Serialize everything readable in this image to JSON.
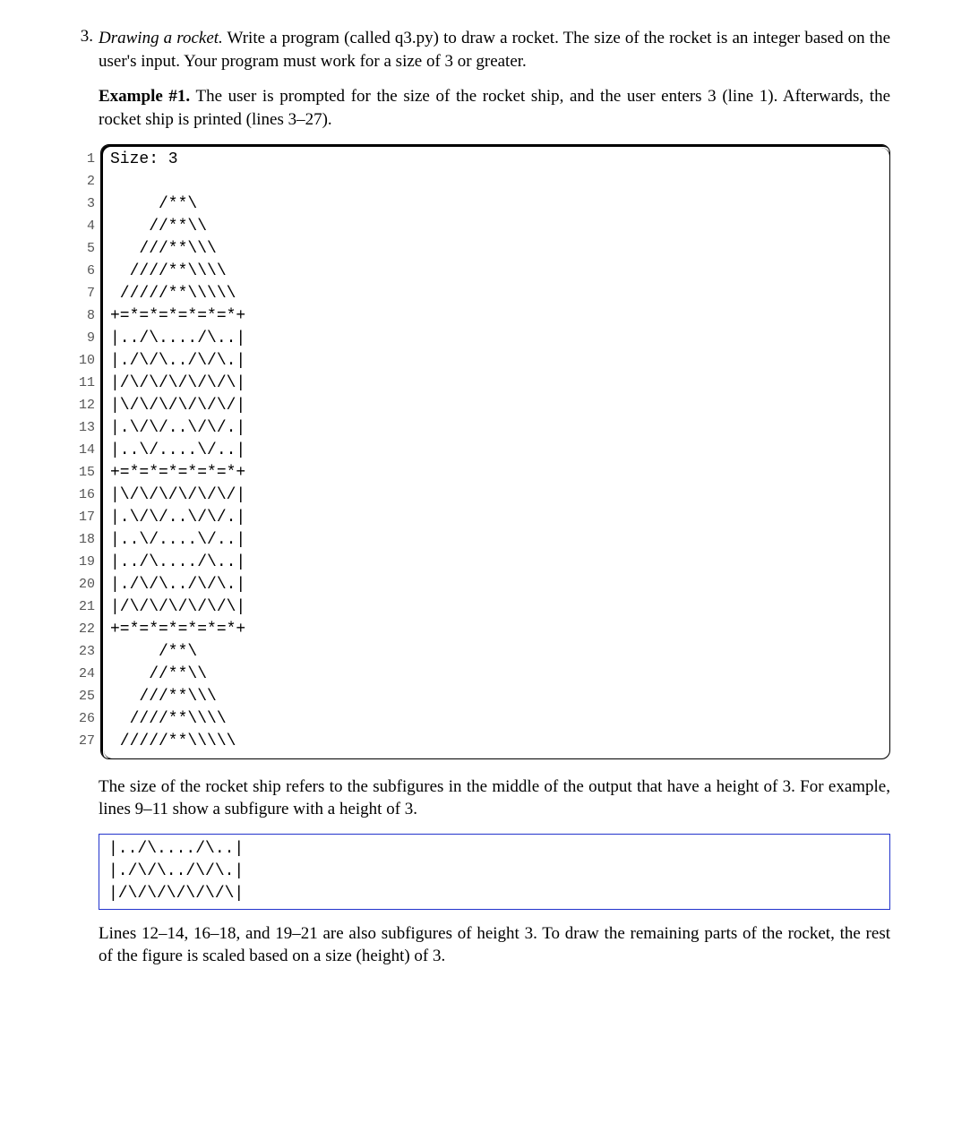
{
  "problem_number": "3.",
  "title_italic": "Drawing a rocket.",
  "intro_rest": " Write a program (called q3.py) to draw a rocket. The size of the rocket is an integer based on the user's input. Your program must work for a size of 3 or greater.",
  "example_label": "Example #1.",
  "example_rest": " The user is prompted for the size of the rocket ship, and the user enters 3 (line 1). Afterwards, the rocket ship is printed (lines 3–27).",
  "code_lines": [
    "Size: 3",
    "",
    "     /**\\",
    "    //**\\\\",
    "   ///**\\\\\\",
    "  ////**\\\\\\\\",
    " /////**\\\\\\\\\\",
    "+=*=*=*=*=*=*+",
    "|../\\..../\\..|",
    "|./\\/\\../\\/\\.|",
    "|/\\/\\/\\/\\/\\/\\|",
    "|\\/\\/\\/\\/\\/\\/|",
    "|.\\/\\/..\\/\\/.|",
    "|..\\/....\\/..|",
    "+=*=*=*=*=*=*+",
    "|\\/\\/\\/\\/\\/\\/|",
    "|.\\/\\/..\\/\\/.|",
    "|..\\/....\\/..|",
    "|../\\..../\\..|",
    "|./\\/\\../\\/\\.|",
    "|/\\/\\/\\/\\/\\/\\|",
    "+=*=*=*=*=*=*+",
    "     /**\\",
    "    //**\\\\",
    "   ///**\\\\\\",
    "  ////**\\\\\\\\",
    " /////**\\\\\\\\\\"
  ],
  "line_numbers": [
    "1",
    "2",
    "3",
    "4",
    "5",
    "6",
    "7",
    "8",
    "9",
    "10",
    "11",
    "12",
    "13",
    "14",
    "15",
    "16",
    "17",
    "18",
    "19",
    "20",
    "21",
    "22",
    "23",
    "24",
    "25",
    "26",
    "27"
  ],
  "after_code_para": "The size of the rocket ship refers to the subfigures in the middle of the output that have a height of 3. For example, lines 9–11 show a subfigure with a height of 3.",
  "snippet_lines": [
    "|../\\..../\\..|",
    "|./\\/\\../\\/\\.|",
    "|/\\/\\/\\/\\/\\/\\|"
  ],
  "final_para": "Lines 12–14, 16–18, and 19–21 are also subfigures of height 3. To draw the remaining parts of the rocket, the rest of the figure is scaled based on a size (height) of 3."
}
